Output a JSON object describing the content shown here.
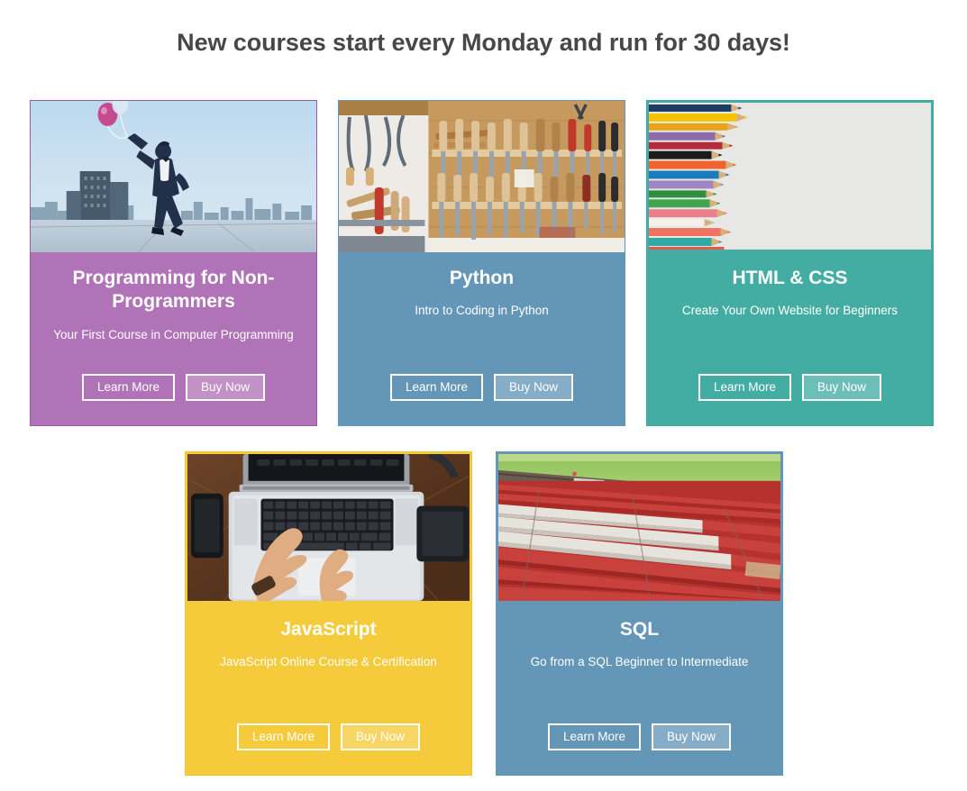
{
  "heading": "New courses start every Monday and run for 30 days!",
  "buttons": {
    "learn_more": "Learn More",
    "buy_now": "Buy Now"
  },
  "colors": {
    "heading_text": "#474747",
    "page_background": "#ffffff",
    "purple": "#b173b7",
    "blue": "#6496b8",
    "teal": "#43ada4",
    "yellow": "#f5cb3c",
    "button_text": "#ffffff",
    "button_border": "#ffffff"
  },
  "cards": [
    {
      "id": "programming-for-non-programmers",
      "title": "Programming for Non-Programmers",
      "subtitle": "Your First Course in Computer Programming",
      "accent": "#b173b7",
      "image_alt": "Man in a suit jumping on a rooftop holding balloons above a city skyline",
      "learn_more": "Learn More",
      "buy_now": "Buy Now"
    },
    {
      "id": "python",
      "title": "Python",
      "subtitle": "Intro to Coding in Python",
      "accent": "#6496b8",
      "image_alt": "Workshop wall of woodworking hand tools: chisels, screwdrivers and saws",
      "learn_more": "Learn More",
      "buy_now": "Buy Now"
    },
    {
      "id": "html-css",
      "title": "HTML & CSS",
      "subtitle": "Create Your Own Website for Beginners",
      "accent": "#43ada4",
      "image_alt": "Row of colored pencils aligned along the left edge of a white surface",
      "learn_more": "Learn More",
      "buy_now": "Buy Now"
    },
    {
      "id": "javascript",
      "title": "JavaScript",
      "subtitle": "JavaScript Online Course & Certification",
      "accent": "#f5cb3c",
      "image_alt": "Overhead view of hands typing on a silver laptop on a dark wooden desk",
      "learn_more": "Learn More",
      "buy_now": "Buy Now"
    },
    {
      "id": "sql",
      "title": "SQL",
      "subtitle": "Go from a SQL Beginner to Intermediate",
      "accent": "#6496b8",
      "image_alt": "Rows of red and white stadium seats beside a green sports field",
      "learn_more": "Learn More",
      "buy_now": "Buy Now"
    }
  ]
}
